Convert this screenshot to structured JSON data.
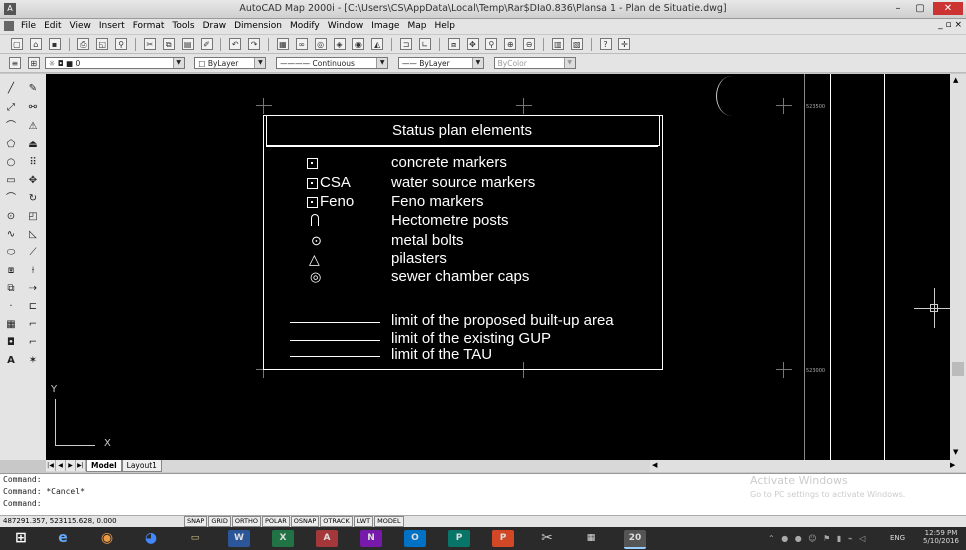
{
  "window": {
    "title": "AutoCAD Map 2000i - [C:\\Users\\CS\\AppData\\Local\\Temp\\Rar$DIa0.836\\Plansa 1 - Plan de Situatie.dwg]",
    "min": "–",
    "max": "▢",
    "close": "✕"
  },
  "menu": {
    "items": [
      "File",
      "Edit",
      "View",
      "Insert",
      "Format",
      "Tools",
      "Draw",
      "Dimension",
      "Modify",
      "Window",
      "Image",
      "Map",
      "Help"
    ],
    "mdi": "_ ▫ ×"
  },
  "toolbar": {
    "layer_value": "0",
    "color_value": "ByLayer",
    "linetype_value": "Continuous",
    "lineweight_value": "ByLayer",
    "plotstyle_value": "ByColor"
  },
  "legend": {
    "title": "Status plan elements",
    "items": [
      {
        "label": "concrete markers",
        "symbol": "square"
      },
      {
        "label": "water source markers",
        "symbol_text": "CSA"
      },
      {
        "label": "Feno markers",
        "symbol_text": "Feno"
      },
      {
        "label": "Hectometre posts",
        "symbol": "post"
      },
      {
        "label": "metal bolts",
        "symbol": "bolt"
      },
      {
        "label": "pilasters",
        "symbol": "triangle"
      },
      {
        "label": "sewer chamber caps",
        "symbol": "double-circle"
      }
    ],
    "lines": [
      {
        "label": "limit of the proposed built-up area"
      },
      {
        "label": "limit of the existing GUP"
      },
      {
        "label": "limit of the TAU"
      }
    ]
  },
  "ucs": {
    "x": "X",
    "y": "Y"
  },
  "tabs": {
    "model": "Model",
    "layout1": "Layout1"
  },
  "command": {
    "lines": [
      "Command:",
      "Command: *Cancel*",
      "Command:"
    ]
  },
  "watermark": {
    "title": "Activate Windows",
    "subtitle": "Go to PC settings to activate Windows."
  },
  "status": {
    "coords": "487291.357, 523115.628, 0.000",
    "buttons": [
      "SNAP",
      "GRID",
      "ORTHO",
      "POLAR",
      "OSNAP",
      "OTRACK",
      "LWT",
      "MODEL"
    ]
  },
  "taskbar": {
    "time": "12:59 PM",
    "lang": "ENG",
    "date": "5/10/2016"
  },
  "drawing": {
    "labels": [
      "523500",
      "523000"
    ]
  },
  "colors": {
    "canvas": "#000000",
    "lines": "#ffffff",
    "taskbar": "#2a2a2a"
  }
}
